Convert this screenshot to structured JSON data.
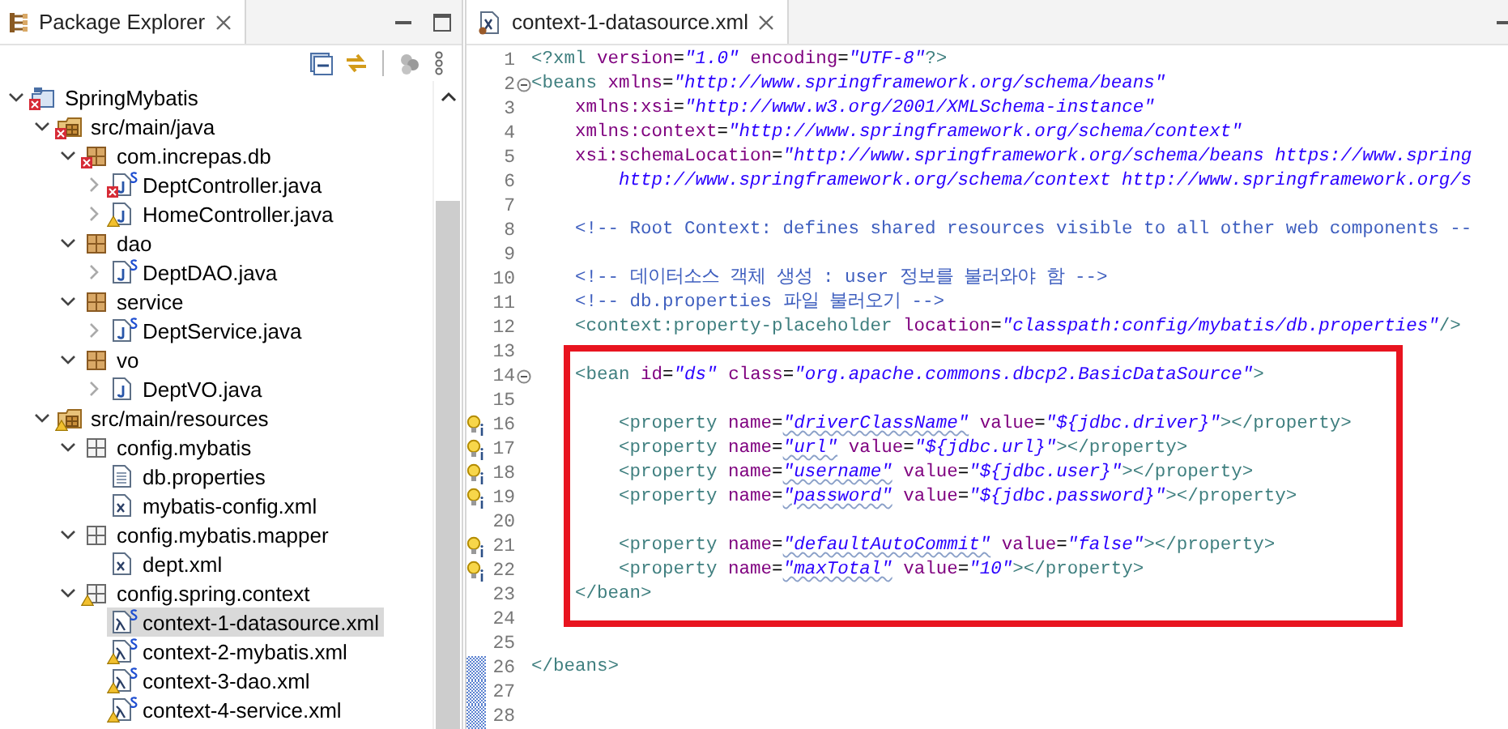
{
  "explorer": {
    "title": "Package Explorer",
    "tree": [
      {
        "label": "SpringMybatis",
        "kind": "project",
        "expanded": true,
        "error": true,
        "children": [
          {
            "label": "src/main/java",
            "kind": "source-folder",
            "expanded": true,
            "error": true,
            "children": [
              {
                "label": "com.increpas.db",
                "kind": "package",
                "expanded": true,
                "error": true,
                "children": [
                  {
                    "label": "DeptController.java",
                    "kind": "java-file",
                    "expanded": false,
                    "error": true,
                    "spring": true
                  },
                  {
                    "label": "HomeController.java",
                    "kind": "java-file",
                    "expanded": false,
                    "warning": true
                  }
                ]
              },
              {
                "label": "dao",
                "kind": "package",
                "expanded": true,
                "children": [
                  {
                    "label": "DeptDAO.java",
                    "kind": "java-file",
                    "expanded": false,
                    "spring": true
                  }
                ]
              },
              {
                "label": "service",
                "kind": "package",
                "expanded": true,
                "children": [
                  {
                    "label": "DeptService.java",
                    "kind": "java-file",
                    "expanded": false,
                    "spring": true
                  }
                ]
              },
              {
                "label": "vo",
                "kind": "package",
                "expanded": true,
                "children": [
                  {
                    "label": "DeptVO.java",
                    "kind": "java-file",
                    "expanded": false
                  }
                ]
              }
            ]
          },
          {
            "label": "src/main/resources",
            "kind": "source-folder",
            "expanded": true,
            "warning": true,
            "children": [
              {
                "label": "config.mybatis",
                "kind": "resource-package",
                "expanded": true,
                "children": [
                  {
                    "label": "db.properties",
                    "kind": "properties-file"
                  },
                  {
                    "label": "mybatis-config.xml",
                    "kind": "xml-file"
                  }
                ]
              },
              {
                "label": "config.mybatis.mapper",
                "kind": "resource-package",
                "expanded": true,
                "children": [
                  {
                    "label": "dept.xml",
                    "kind": "xml-file"
                  }
                ]
              },
              {
                "label": "config.spring.context",
                "kind": "resource-package",
                "expanded": true,
                "warning": true,
                "children": [
                  {
                    "label": "context-1-datasource.xml",
                    "kind": "spring-xml",
                    "selected": true,
                    "spring": true
                  },
                  {
                    "label": "context-2-mybatis.xml",
                    "kind": "spring-xml",
                    "selected": false,
                    "warning": true,
                    "spring": true
                  },
                  {
                    "label": "context-3-dao.xml",
                    "kind": "spring-xml",
                    "selected": false,
                    "warning": true,
                    "spring": true
                  },
                  {
                    "label": "context-4-service.xml",
                    "kind": "spring-xml",
                    "selected": false,
                    "warning": true,
                    "spring": true
                  }
                ]
              }
            ]
          }
        ]
      }
    ]
  },
  "editor": {
    "tab": {
      "title": "context-1-datasource.xml"
    },
    "blocks": [
      {
        "kind": "plain",
        "lines": [
          {
            "number": "1",
            "tokens": [
              {
                "kind": "tag",
                "text": "<?xml "
              },
              {
                "kind": "attr",
                "text": "version"
              },
              {
                "kind": "plain",
                "text": "="
              },
              {
                "kind": "value",
                "text": "\"1.0\""
              },
              {
                "kind": "attr",
                "text": " encoding"
              },
              {
                "kind": "plain",
                "text": "="
              },
              {
                "kind": "value",
                "text": "\"UTF-8\""
              },
              {
                "kind": "tag",
                "text": "?>"
              }
            ]
          },
          {
            "number": "2",
            "fold": true,
            "tokens": [
              {
                "kind": "tag",
                "text": "<beans "
              },
              {
                "kind": "attr",
                "text": "xmlns"
              },
              {
                "kind": "plain",
                "text": "="
              },
              {
                "kind": "value",
                "text": "\"http://www.springframework.org/schema/beans\""
              }
            ]
          },
          {
            "number": "3",
            "tokens": [
              {
                "kind": "attr",
                "text": "    xmlns:xsi"
              },
              {
                "kind": "plain",
                "text": "="
              },
              {
                "kind": "value",
                "text": "\"http://www.w3.org/2001/XMLSchema-instance\""
              }
            ]
          },
          {
            "number": "4",
            "tokens": [
              {
                "kind": "attr",
                "text": "    xmlns:context"
              },
              {
                "kind": "plain",
                "text": "="
              },
              {
                "kind": "value",
                "text": "\"http://www.springframework.org/schema/context\""
              }
            ]
          },
          {
            "number": "5",
            "tokens": [
              {
                "kind": "attr",
                "text": "    xsi:schemaLocation"
              },
              {
                "kind": "plain",
                "text": "="
              },
              {
                "kind": "value",
                "text": "\"http://www.springframework.org/schema/beans https://www.spring"
              }
            ]
          },
          {
            "number": "6",
            "tokens": [
              {
                "kind": "value",
                "text": "        http://www.springframework.org/schema/context http://www.springframework.org/s"
              }
            ]
          },
          {
            "number": "7"
          },
          {
            "number": "8",
            "tokens": [
              {
                "kind": "comment",
                "text": "    <!-- Root Context: defines shared resources visible to all other web components --"
              }
            ]
          },
          {
            "number": "9"
          },
          {
            "number": "10",
            "tokens": [
              {
                "kind": "comment",
                "text": "    <!-- 데이터소스 객체 생성 : user 정보를 불러와야 함 -->"
              }
            ]
          },
          {
            "number": "11",
            "tokens": [
              {
                "kind": "comment",
                "text": "    <!-- db.properties 파일 불러오기 -->"
              }
            ]
          },
          {
            "number": "12",
            "tokens": [
              {
                "kind": "tag",
                "text": "    <context:property-placeholder "
              },
              {
                "kind": "attr",
                "text": "location"
              },
              {
                "kind": "plain",
                "text": "="
              },
              {
                "kind": "value",
                "text": "\"classpath:config/mybatis/db.properties\""
              },
              {
                "kind": "tag",
                "text": "/>"
              }
            ]
          },
          {
            "number": "13"
          }
        ]
      },
      {
        "kind": "boxed",
        "lines": [
          {
            "number": "14",
            "fold": true,
            "tokens": [
              {
                "kind": "tag",
                "text": "    <bean "
              },
              {
                "kind": "attr",
                "text": "id"
              },
              {
                "kind": "plain",
                "text": "="
              },
              {
                "kind": "value",
                "text": "\"ds\""
              },
              {
                "kind": "attr",
                "text": " class"
              },
              {
                "kind": "plain",
                "text": "="
              },
              {
                "kind": "value",
                "text": "\"org.apache.commons.dbcp2.BasicDataSource\""
              },
              {
                "kind": "tag",
                "text": ">"
              }
            ]
          },
          {
            "number": "15"
          },
          {
            "number": "16",
            "hint": true,
            "tokens": [
              {
                "kind": "tag",
                "text": "        <property "
              },
              {
                "kind": "attr",
                "text": "name"
              },
              {
                "kind": "plain",
                "text": "="
              },
              {
                "kind": "value",
                "text": "\"driverClassName\"",
                "squiggle": true
              },
              {
                "kind": "attr",
                "text": " value"
              },
              {
                "kind": "plain",
                "text": "="
              },
              {
                "kind": "value",
                "text": "\"${jdbc.driver}\""
              },
              {
                "kind": "tag",
                "text": "></property>"
              }
            ]
          },
          {
            "number": "17",
            "hint": true,
            "tokens": [
              {
                "kind": "tag",
                "text": "        <property "
              },
              {
                "kind": "attr",
                "text": "name"
              },
              {
                "kind": "plain",
                "text": "="
              },
              {
                "kind": "value",
                "text": "\"url\"",
                "squiggle": true
              },
              {
                "kind": "attr",
                "text": " value"
              },
              {
                "kind": "plain",
                "text": "="
              },
              {
                "kind": "value",
                "text": "\"${jdbc.url}\""
              },
              {
                "kind": "tag",
                "text": "></property>"
              }
            ]
          },
          {
            "number": "18",
            "hint": true,
            "tokens": [
              {
                "kind": "tag",
                "text": "        <property "
              },
              {
                "kind": "attr",
                "text": "name"
              },
              {
                "kind": "plain",
                "text": "="
              },
              {
                "kind": "value",
                "text": "\"username\"",
                "squiggle": true
              },
              {
                "kind": "attr",
                "text": " value"
              },
              {
                "kind": "plain",
                "text": "="
              },
              {
                "kind": "value",
                "text": "\"${jdbc.user}\""
              },
              {
                "kind": "tag",
                "text": "></property>"
              }
            ]
          },
          {
            "number": "19",
            "hint": true,
            "tokens": [
              {
                "kind": "tag",
                "text": "        <property "
              },
              {
                "kind": "attr",
                "text": "name"
              },
              {
                "kind": "plain",
                "text": "="
              },
              {
                "kind": "value",
                "text": "\"password\"",
                "squiggle": true
              },
              {
                "kind": "attr",
                "text": " value"
              },
              {
                "kind": "plain",
                "text": "="
              },
              {
                "kind": "value",
                "text": "\"${jdbc.password}\""
              },
              {
                "kind": "tag",
                "text": "></property>"
              }
            ]
          },
          {
            "number": "20"
          },
          {
            "number": "21",
            "hint": true,
            "tokens": [
              {
                "kind": "tag",
                "text": "        <property "
              },
              {
                "kind": "attr",
                "text": "name"
              },
              {
                "kind": "plain",
                "text": "="
              },
              {
                "kind": "value",
                "text": "\"defaultAutoCommit\"",
                "squiggle": true
              },
              {
                "kind": "attr",
                "text": " value"
              },
              {
                "kind": "plain",
                "text": "="
              },
              {
                "kind": "value",
                "text": "\"false\""
              },
              {
                "kind": "tag",
                "text": "></property>"
              }
            ]
          },
          {
            "number": "22",
            "hint": true,
            "tokens": [
              {
                "kind": "tag",
                "text": "        <property "
              },
              {
                "kind": "attr",
                "text": "name"
              },
              {
                "kind": "plain",
                "text": "="
              },
              {
                "kind": "value",
                "text": "\"maxTotal\"",
                "squiggle": true
              },
              {
                "kind": "attr",
                "text": " value"
              },
              {
                "kind": "plain",
                "text": "="
              },
              {
                "kind": "value",
                "text": "\"10\""
              },
              {
                "kind": "tag",
                "text": "></property>"
              }
            ]
          },
          {
            "number": "23",
            "tokens": [
              {
                "kind": "tag",
                "text": "    </bean>"
              }
            ]
          }
        ]
      },
      {
        "kind": "plain",
        "lines": [
          {
            "number": "24"
          },
          {
            "number": "25"
          },
          {
            "number": "26",
            "changed": true,
            "tokens": [
              {
                "kind": "tag",
                "text": "</beans>"
              }
            ]
          },
          {
            "number": "27",
            "changed": true
          },
          {
            "number": "28",
            "changed": true
          }
        ]
      }
    ]
  }
}
